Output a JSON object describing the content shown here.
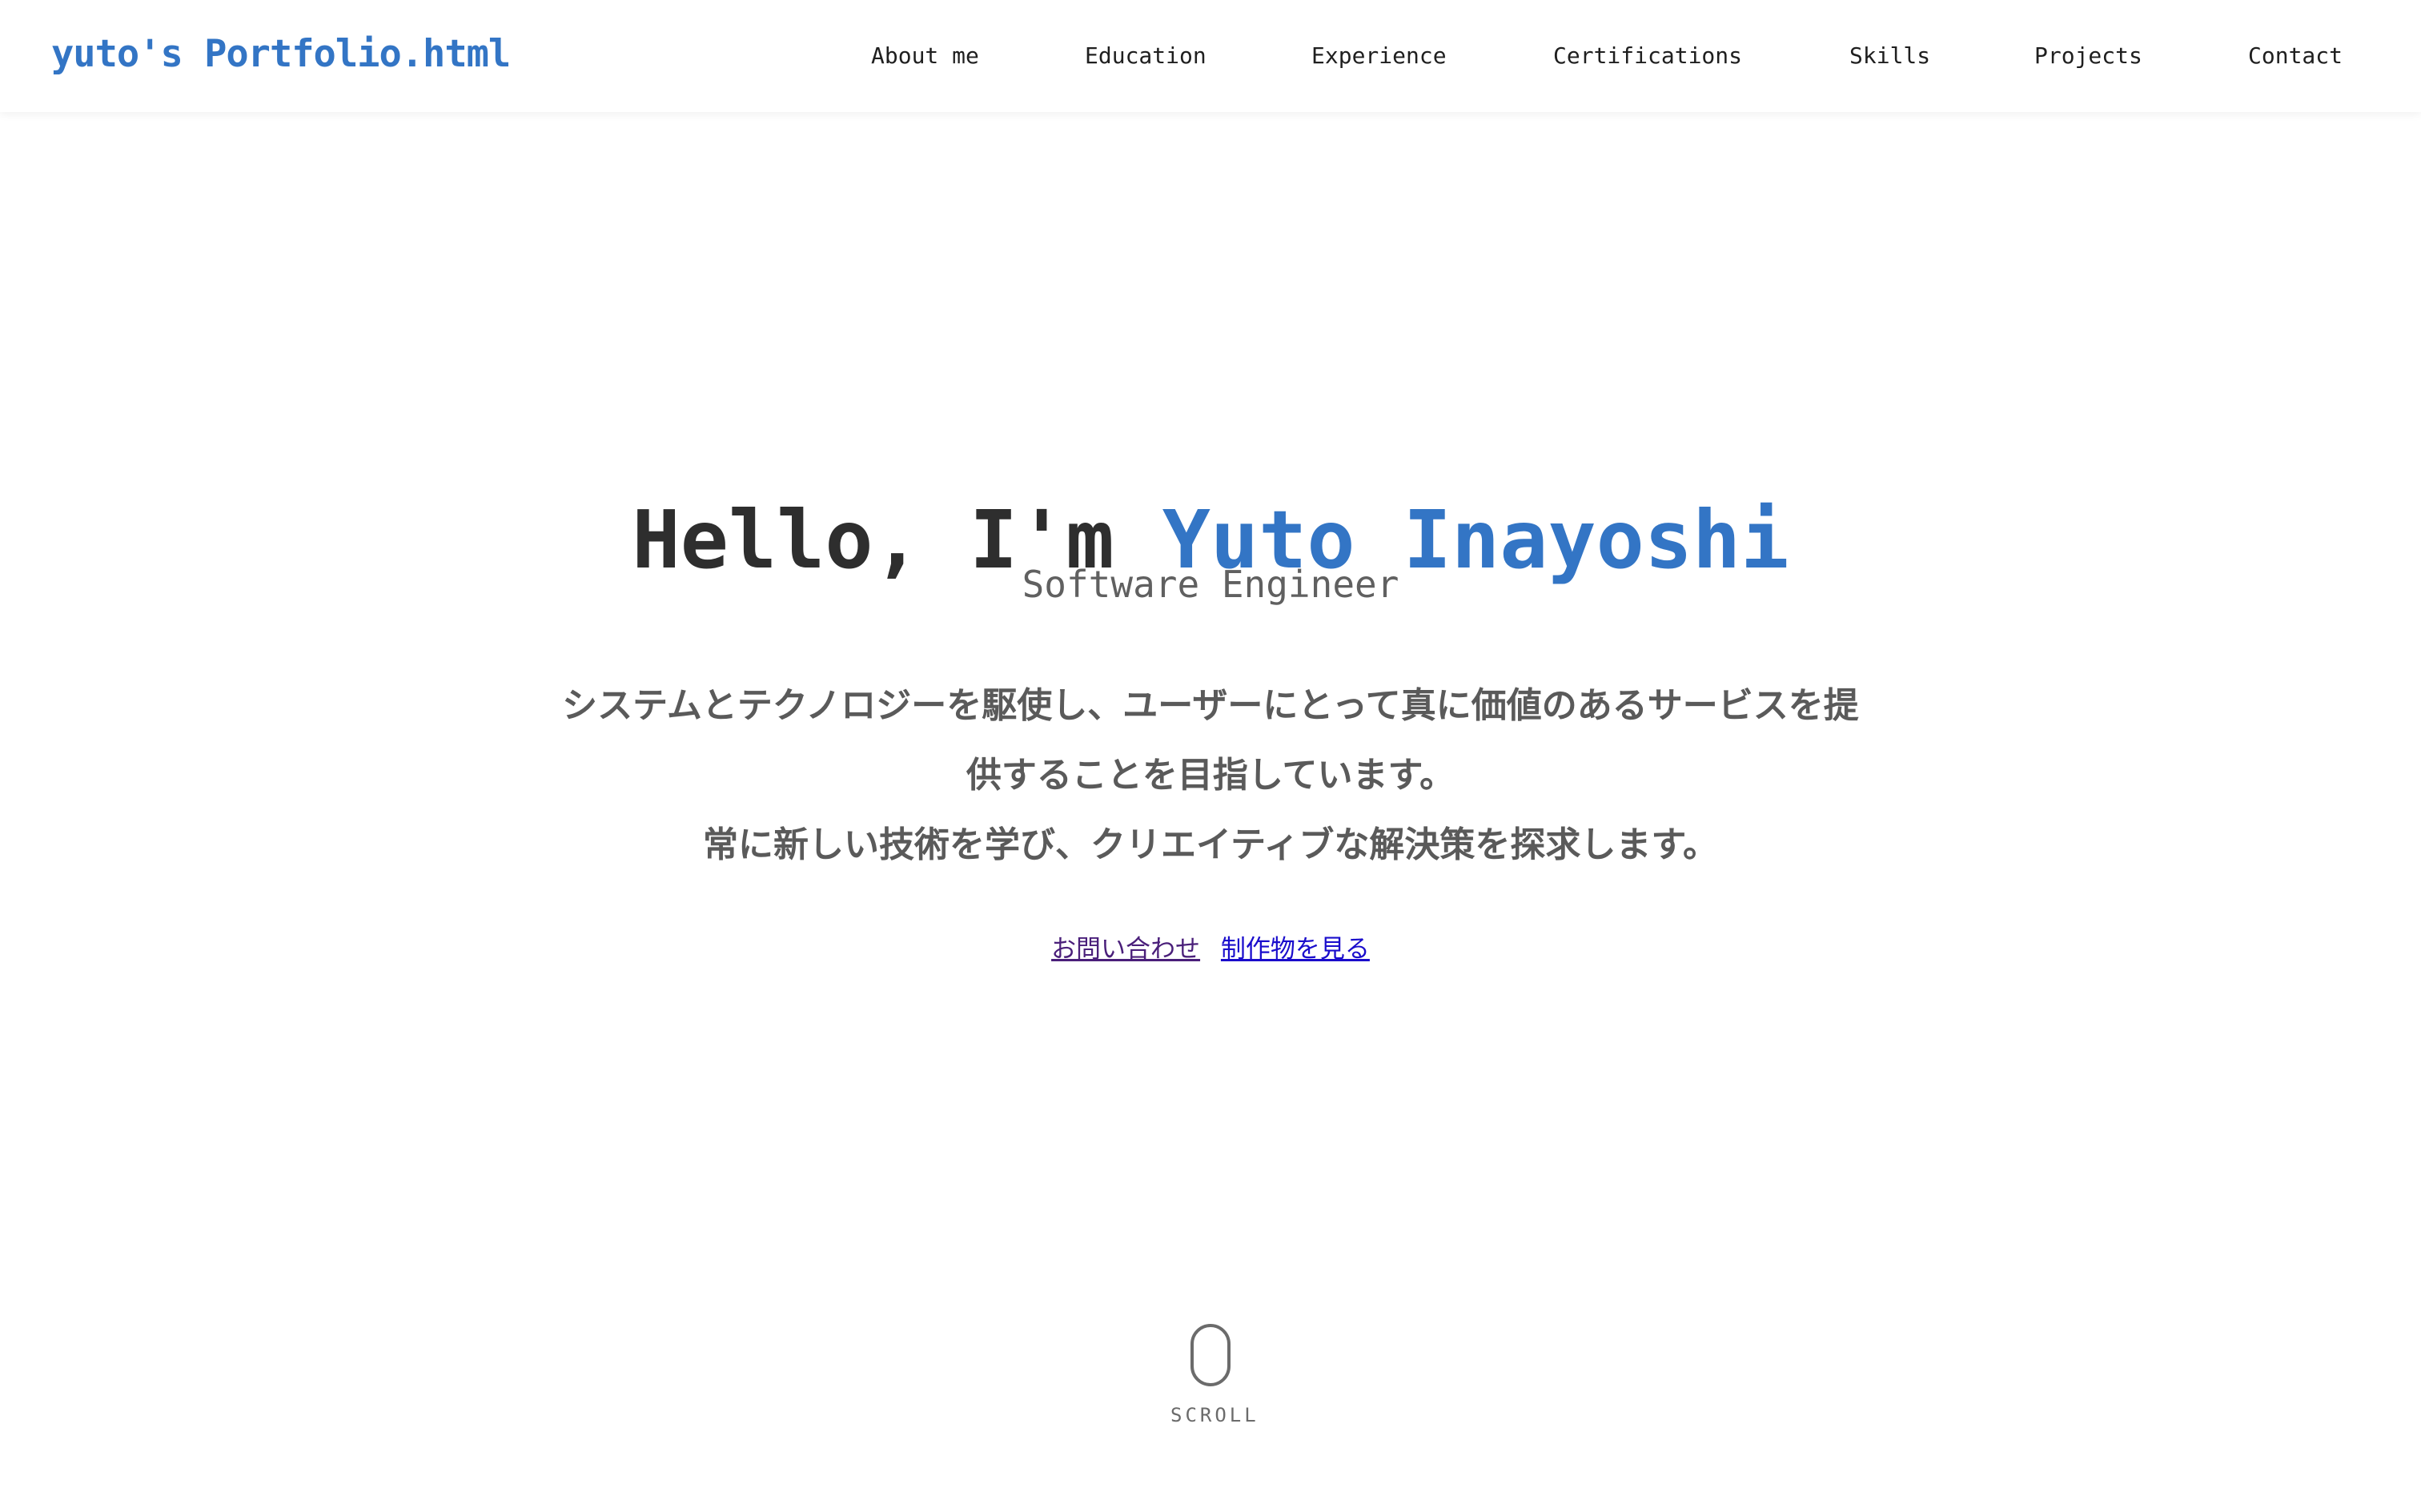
{
  "header": {
    "brand": "yuto's Portfolio.html",
    "nav": [
      {
        "label": "About me"
      },
      {
        "label": "Education"
      },
      {
        "label": "Experience"
      },
      {
        "label": "Certifications"
      },
      {
        "label": "Skills"
      },
      {
        "label": "Projects"
      },
      {
        "label": "Contact"
      }
    ]
  },
  "hero": {
    "greeting": "Hello, I'm ",
    "name": "Yuto Inayoshi",
    "subtitle": "Software Engineer",
    "intro_line1": "システムとテクノロジーを駆使し、ユーザーにとって真に価値のあるサービスを提供することを目指しています。",
    "intro_line2": "常に新しい技術を学び、クリエイティブな解決策を探求します。",
    "cta_contact": "お問い合わせ",
    "cta_projects": "制作物を見る"
  },
  "scroll": {
    "label": "SCROLL",
    "icon": "mouse-icon"
  },
  "colors": {
    "accent": "#3375c5",
    "text_dark": "#2e2e2e",
    "text_muted": "#5a5a5a"
  }
}
